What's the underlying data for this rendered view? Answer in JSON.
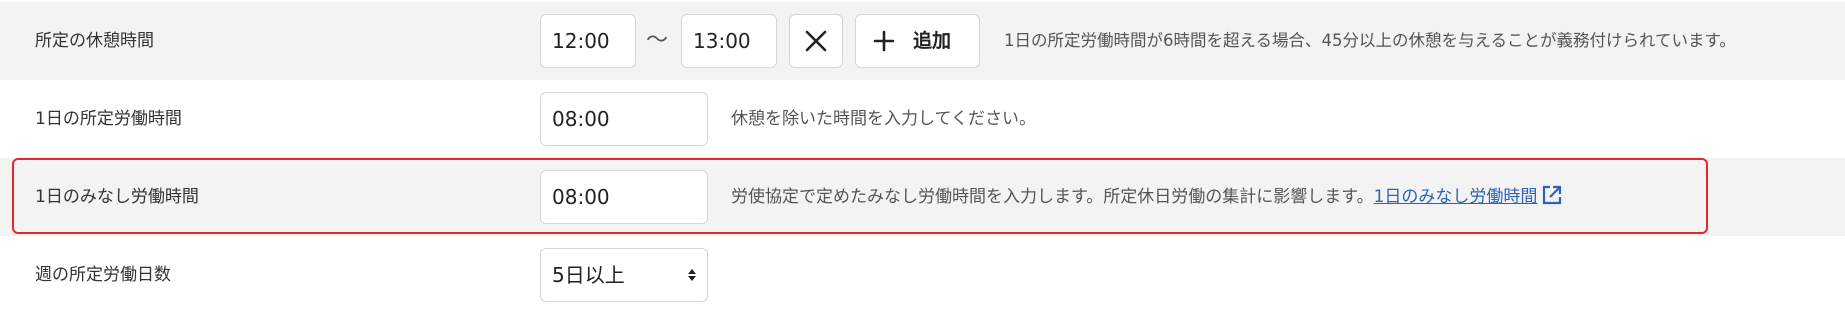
{
  "rows": {
    "break_time": {
      "label": "所定の休憩時間",
      "start": "12:00",
      "separator": "～",
      "end": "13:00",
      "add_label": "追加",
      "help": "1日の所定労働時間が6時間を超える場合、45分以上の休憩を与えることが義務付けられています。"
    },
    "daily_hours": {
      "label": "1日の所定労働時間",
      "value": "08:00",
      "help": "休憩を除いた時間を入力してください。"
    },
    "deemed_hours": {
      "label": "1日のみなし労働時間",
      "value": "08:00",
      "help": "労使協定で定めたみなし労働時間を入力します。所定休日労働の集計に影響します。",
      "link": "1日のみなし労働時間"
    },
    "weekly_days": {
      "label": "週の所定労働日数",
      "selected": "5日以上"
    }
  },
  "colors": {
    "row_gray": "#f4f3f3",
    "highlight_border": "#e8262b",
    "link": "#2a63b8"
  },
  "icons": {
    "remove": "close-icon",
    "add": "plus-icon",
    "external": "external-link-icon",
    "select": "select-arrows-icon"
  }
}
